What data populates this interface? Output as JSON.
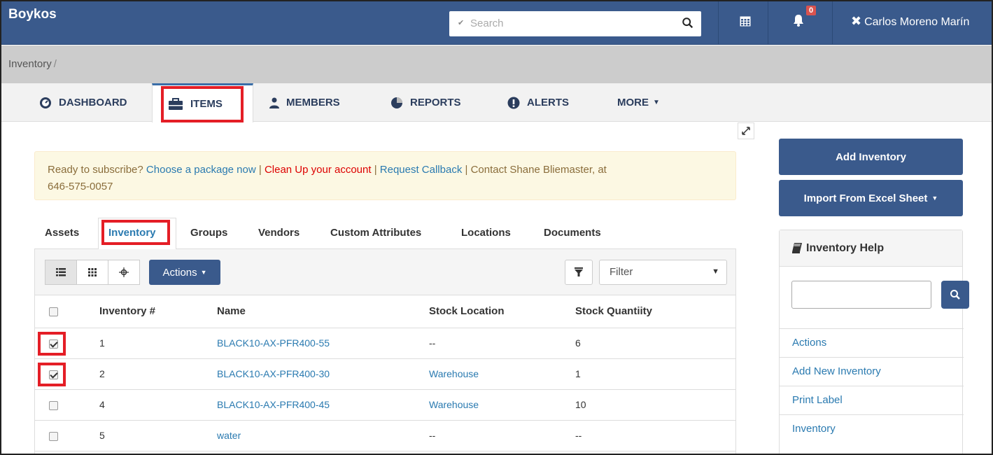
{
  "app": {
    "brand": "Boykos"
  },
  "search": {
    "placeholder": "Search"
  },
  "notifications": {
    "count": "0"
  },
  "user": {
    "name": "Carlos Moreno Marín"
  },
  "breadcrumb": {
    "root": "Inventory",
    "separator": "/"
  },
  "main_tabs": [
    {
      "label": "DASHBOARD",
      "icon": "dashboard-icon"
    },
    {
      "label": "ITEMS",
      "icon": "briefcase-icon",
      "active": true
    },
    {
      "label": "MEMBERS",
      "icon": "user-icon"
    },
    {
      "label": "REPORTS",
      "icon": "pie-chart-icon"
    },
    {
      "label": "ALERTS",
      "icon": "exclamation-icon"
    },
    {
      "label": "MORE",
      "icon": "caret-down-icon"
    }
  ],
  "alert": {
    "prefix": "Ready to subscribe? ",
    "link1": "Choose a package now",
    "pipe": " | ",
    "link2": "Clean Up your account",
    "link3": "Request Callback",
    "contact": "Contact Shane Bliemaster, at",
    "phone": "646-575-0057"
  },
  "sub_tabs": [
    {
      "label": "Assets"
    },
    {
      "label": "Inventory",
      "active": true
    },
    {
      "label": "Groups"
    },
    {
      "label": "Vendors"
    },
    {
      "label": "Custom Attributes"
    },
    {
      "label": "Locations"
    },
    {
      "label": "Documents"
    }
  ],
  "toolbar": {
    "actions_label": "Actions",
    "filter_label": "Filter"
  },
  "table": {
    "columns": [
      "Inventory #",
      "Name",
      "Stock Location",
      "Stock Quantiity"
    ],
    "rows": [
      {
        "checked": true,
        "number": "1",
        "name": "BLACK10-AX-PFR400-55",
        "location": "--",
        "location_link": false,
        "quantity": "6"
      },
      {
        "checked": true,
        "number": "2",
        "name": "BLACK10-AX-PFR400-30",
        "location": "Warehouse",
        "location_link": true,
        "quantity": "1"
      },
      {
        "checked": false,
        "number": "4",
        "name": "BLACK10-AX-PFR400-45",
        "location": "Warehouse",
        "location_link": true,
        "quantity": "10"
      },
      {
        "checked": false,
        "number": "5",
        "name": "water",
        "location": "--",
        "location_link": false,
        "quantity": "--"
      }
    ]
  },
  "sidebar": {
    "add_inventory": "Add Inventory",
    "import": "Import From Excel Sheet",
    "help_title": "Inventory Help",
    "help_links": [
      "Actions",
      "Add New Inventory",
      "Print Label",
      "Inventory"
    ]
  },
  "colors": {
    "navbar": "#3a5a8c",
    "link": "#2a7ab0",
    "highlight": "#e41e26",
    "alert_bg": "#fcf8e3"
  }
}
